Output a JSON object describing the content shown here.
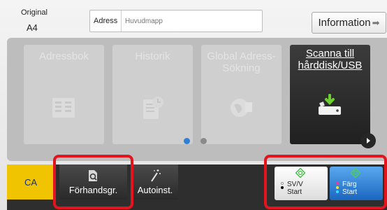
{
  "header": {
    "original_label": "Original",
    "original_value": "A4",
    "address_label": "Adress",
    "address_placeholder": "Huvudmapp",
    "info_button": "Information"
  },
  "tiles": [
    {
      "label": "Adressbok",
      "icon": "address-book-icon",
      "active": false
    },
    {
      "label": "Historik",
      "icon": "history-icon",
      "active": false
    },
    {
      "label": "Global Adress-Sökning",
      "icon": "globe-search-icon",
      "active": false
    },
    {
      "label": "Scanna till hårddisk/USB",
      "icon": "hdd-usb-icon",
      "active": true
    }
  ],
  "pagination": {
    "pages": 2,
    "current": 1
  },
  "bottom_bar": {
    "ca_label": "CA",
    "preview_label": "Förhandsgr.",
    "auto_label": "Autoinst.",
    "start_bw": {
      "line1": "SV/V",
      "line2": "Start"
    },
    "start_color": {
      "line1": "Färg",
      "line2": "Start"
    }
  },
  "colors": {
    "ca_button": "#f0c400",
    "start_color": "#2a7fd9",
    "start_green": "#3fbf3f",
    "highlight": "#e3141b",
    "page_dot_active": "#2f7fd6"
  }
}
